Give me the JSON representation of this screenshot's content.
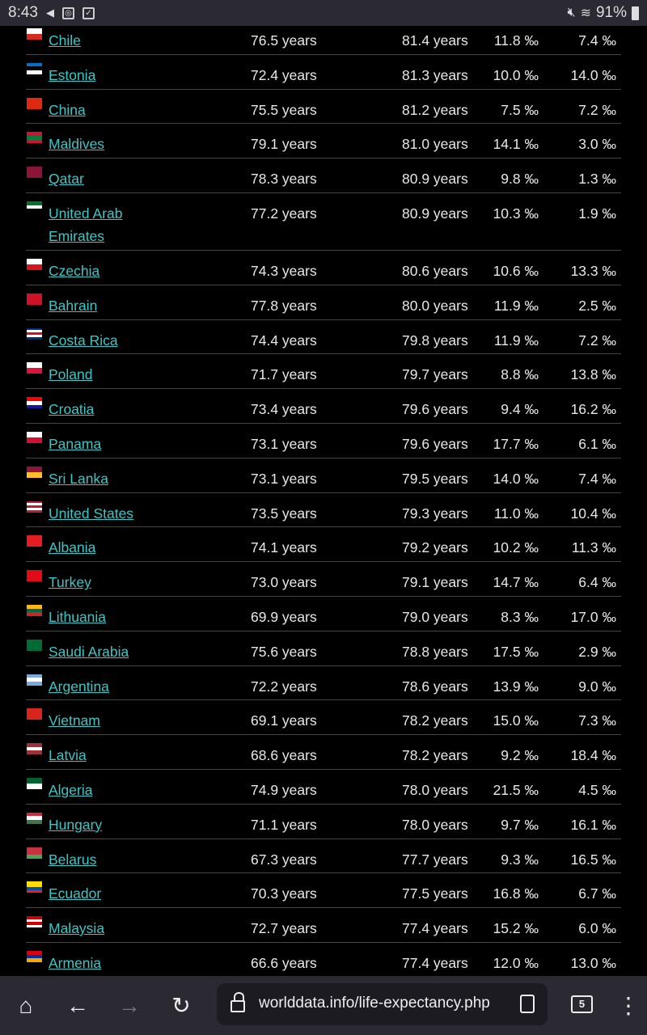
{
  "status_bar": {
    "time": "8:43",
    "battery": "91%"
  },
  "rows": [
    {
      "country": "Chile",
      "male": "76.5 years",
      "female": "81.4 years",
      "birth": "11.8 ‰",
      "death": "7.4 ‰",
      "flag": [
        "#ffffff",
        "#d52b1e"
      ]
    },
    {
      "country": "Estonia",
      "male": "72.4 years",
      "female": "81.3 years",
      "birth": "10.0 ‰",
      "death": "14.0 ‰",
      "flag": [
        "#0072ce",
        "#000000",
        "#ffffff"
      ]
    },
    {
      "country": "China",
      "male": "75.5 years",
      "female": "81.2 years",
      "birth": "7.5 ‰",
      "death": "7.2 ‰",
      "flag": [
        "#de2910"
      ]
    },
    {
      "country": "Maldives",
      "male": "79.1 years",
      "female": "81.0 years",
      "birth": "14.1 ‰",
      "death": "3.0 ‰",
      "flag": [
        "#d21034",
        "#007e3a",
        "#d21034"
      ]
    },
    {
      "country": "Qatar",
      "male": "78.3 years",
      "female": "80.9 years",
      "birth": "9.8 ‰",
      "death": "1.3 ‰",
      "flag": [
        "#8a1538"
      ]
    },
    {
      "country": "United Arab Emirates",
      "male": "77.2 years",
      "female": "80.9 years",
      "birth": "10.3 ‰",
      "death": "1.9 ‰",
      "flag": [
        "#00732f",
        "#ffffff",
        "#000000"
      ],
      "tall": true
    },
    {
      "country": "Czechia",
      "male": "74.3 years",
      "female": "80.6 years",
      "birth": "10.6 ‰",
      "death": "13.3 ‰",
      "flag": [
        "#ffffff",
        "#d7141a"
      ]
    },
    {
      "country": "Bahrain",
      "male": "77.8 years",
      "female": "80.0 years",
      "birth": "11.9 ‰",
      "death": "2.5 ‰",
      "flag": [
        "#ce1126"
      ]
    },
    {
      "country": "Costa Rica",
      "male": "74.4 years",
      "female": "79.8 years",
      "birth": "11.9 ‰",
      "death": "7.2 ‰",
      "flag": [
        "#002b7f",
        "#ffffff",
        "#ce1126",
        "#ffffff",
        "#002b7f"
      ]
    },
    {
      "country": "Poland",
      "male": "71.7 years",
      "female": "79.7 years",
      "birth": "8.8 ‰",
      "death": "13.8 ‰",
      "flag": [
        "#ffffff",
        "#dc143c"
      ]
    },
    {
      "country": "Croatia",
      "male": "73.4 years",
      "female": "79.6 years",
      "birth": "9.4 ‰",
      "death": "16.2 ‰",
      "flag": [
        "#ff0000",
        "#ffffff",
        "#171796"
      ]
    },
    {
      "country": "Panama",
      "male": "73.1 years",
      "female": "79.6 years",
      "birth": "17.7 ‰",
      "death": "6.1 ‰",
      "flag": [
        "#ffffff",
        "#d21034"
      ]
    },
    {
      "country": "Sri Lanka",
      "male": "73.1 years",
      "female": "79.5 years",
      "birth": "14.0 ‰",
      "death": "7.4 ‰",
      "flag": [
        "#8d153a",
        "#ffbe29"
      ]
    },
    {
      "country": "United States",
      "male": "73.5 years",
      "female": "79.3 years",
      "birth": "11.0 ‰",
      "death": "10.4 ‰",
      "flag": [
        "#b22234",
        "#ffffff",
        "#b22234",
        "#ffffff",
        "#b22234"
      ]
    },
    {
      "country": "Albania",
      "male": "74.1 years",
      "female": "79.2 years",
      "birth": "10.2 ‰",
      "death": "11.3 ‰",
      "flag": [
        "#e41e20"
      ]
    },
    {
      "country": "Turkey",
      "male": "73.0 years",
      "female": "79.1 years",
      "birth": "14.7 ‰",
      "death": "6.4 ‰",
      "flag": [
        "#e30a17"
      ]
    },
    {
      "country": "Lithuania",
      "male": "69.9 years",
      "female": "79.0 years",
      "birth": "8.3 ‰",
      "death": "17.0 ‰",
      "flag": [
        "#fdb913",
        "#006a44",
        "#c1272d"
      ]
    },
    {
      "country": "Saudi Arabia",
      "male": "75.6 years",
      "female": "78.8 years",
      "birth": "17.5 ‰",
      "death": "2.9 ‰",
      "flag": [
        "#006c35"
      ]
    },
    {
      "country": "Argentina",
      "male": "72.2 years",
      "female": "78.6 years",
      "birth": "13.9 ‰",
      "death": "9.0 ‰",
      "flag": [
        "#74acdf",
        "#ffffff",
        "#74acdf"
      ]
    },
    {
      "country": "Vietnam",
      "male": "69.1 years",
      "female": "78.2 years",
      "birth": "15.0 ‰",
      "death": "7.3 ‰",
      "flag": [
        "#da251d"
      ]
    },
    {
      "country": "Latvia",
      "male": "68.6 years",
      "female": "78.2 years",
      "birth": "9.2 ‰",
      "death": "18.4 ‰",
      "flag": [
        "#9e3039",
        "#ffffff",
        "#9e3039"
      ]
    },
    {
      "country": "Algeria",
      "male": "74.9 years",
      "female": "78.0 years",
      "birth": "21.5 ‰",
      "death": "4.5 ‰",
      "flag": [
        "#006233",
        "#ffffff"
      ]
    },
    {
      "country": "Hungary",
      "male": "71.1 years",
      "female": "78.0 years",
      "birth": "9.7 ‰",
      "death": "16.1 ‰",
      "flag": [
        "#ce2939",
        "#ffffff",
        "#477050"
      ]
    },
    {
      "country": "Belarus",
      "male": "67.3 years",
      "female": "77.7 years",
      "birth": "9.3 ‰",
      "death": "16.5 ‰",
      "flag": [
        "#c8313e",
        "#c8313e",
        "#4aa657"
      ]
    },
    {
      "country": "Ecuador",
      "male": "70.3 years",
      "female": "77.5 years",
      "birth": "16.8 ‰",
      "death": "6.7 ‰",
      "flag": [
        "#ffdd00",
        "#ffdd00",
        "#034ea2",
        "#ed1c24"
      ]
    },
    {
      "country": "Malaysia",
      "male": "72.7 years",
      "female": "77.4 years",
      "birth": "15.2 ‰",
      "death": "6.0 ‰",
      "flag": [
        "#cc0001",
        "#ffffff",
        "#cc0001",
        "#ffffff"
      ]
    },
    {
      "country": "Armenia",
      "male": "66.6 years",
      "female": "77.4 years",
      "birth": "12.0 ‰",
      "death": "13.0 ‰",
      "flag": [
        "#d90012",
        "#0033a0",
        "#f2a800"
      ]
    }
  ],
  "browser": {
    "url": "worlddata.info/life-expectancy.php",
    "tab_count": "5"
  },
  "colors": {
    "link": "#3cc6c6",
    "chrome": "#2b2a33"
  }
}
